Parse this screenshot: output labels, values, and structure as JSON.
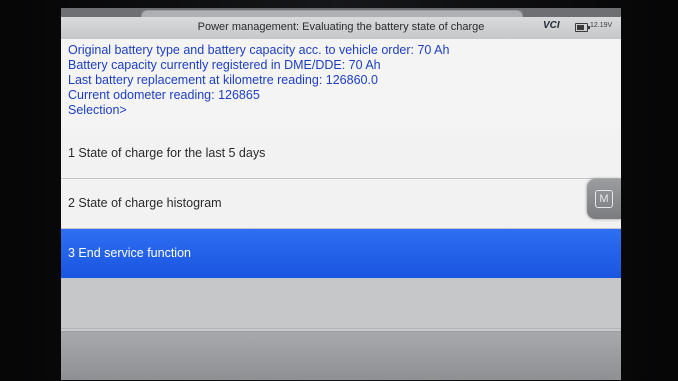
{
  "header": {
    "title": "Power management: Evaluating the battery state of charge",
    "vci_label": "VCI",
    "voltage": "12.19V"
  },
  "info": {
    "lines": [
      "Original battery type and battery capacity acc. to vehicle order: 70 Ah",
      "Battery capacity currently registered in DME/DDE: 70 Ah",
      "Last battery replacement at kilometre reading: 126860.0",
      "Current odometer reading: 126865",
      "Selection>"
    ]
  },
  "menu": {
    "items": [
      {
        "label": "1 State of charge for the last 5 days",
        "selected": false
      },
      {
        "label": "2 State of charge histogram",
        "selected": false
      },
      {
        "label": "3 End service function",
        "selected": true
      }
    ]
  },
  "side_button": {
    "label": "M",
    "icon": "m-icon"
  },
  "colors": {
    "info_text": "#1d3fbf",
    "selected_row": "#1a55e0",
    "panel_bg": "#f4f4f5"
  }
}
